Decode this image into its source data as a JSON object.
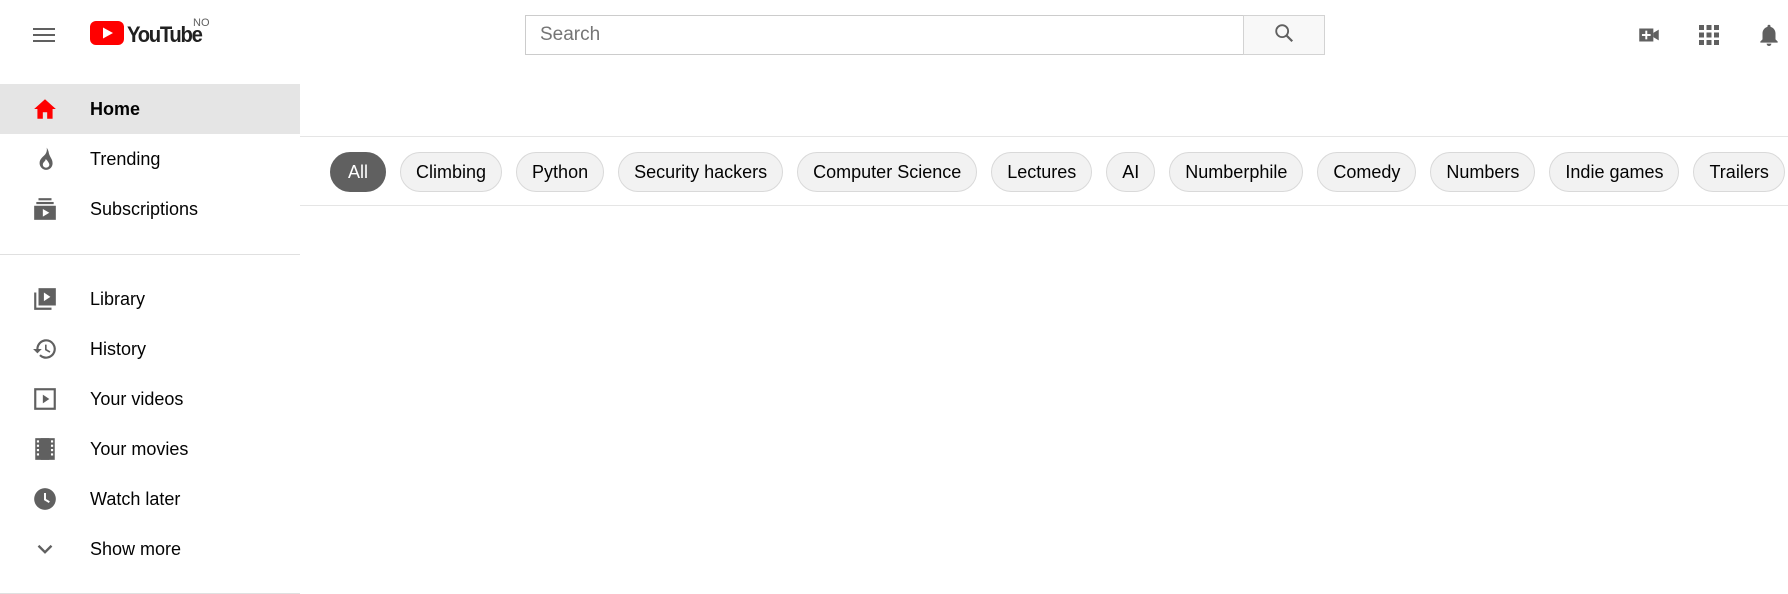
{
  "masthead": {
    "logo_text": "YouTube",
    "country_code": "NO",
    "search_placeholder": "Search",
    "search_value": "",
    "icons": [
      "menu-icon",
      "youtube-logo-icon",
      "search-icon",
      "create-video-icon",
      "apps-icon",
      "notifications-icon"
    ]
  },
  "sidebar": {
    "primary": [
      {
        "label": "Home",
        "icon": "home-icon",
        "active": true
      },
      {
        "label": "Trending",
        "icon": "trending-icon",
        "active": false
      },
      {
        "label": "Subscriptions",
        "icon": "subscriptions-icon",
        "active": false
      }
    ],
    "secondary": [
      {
        "label": "Library",
        "icon": "library-icon"
      },
      {
        "label": "History",
        "icon": "history-icon"
      },
      {
        "label": "Your videos",
        "icon": "your-videos-icon"
      },
      {
        "label": "Your movies",
        "icon": "movies-icon"
      },
      {
        "label": "Watch later",
        "icon": "watch-later-icon"
      },
      {
        "label": "Show more",
        "icon": "chevron-down-icon"
      }
    ]
  },
  "chips": [
    {
      "label": "All",
      "selected": true
    },
    {
      "label": "Climbing",
      "selected": false
    },
    {
      "label": "Python",
      "selected": false
    },
    {
      "label": "Security hackers",
      "selected": false
    },
    {
      "label": "Computer Science",
      "selected": false
    },
    {
      "label": "Lectures",
      "selected": false
    },
    {
      "label": "AI",
      "selected": false
    },
    {
      "label": "Numberphile",
      "selected": false
    },
    {
      "label": "Comedy",
      "selected": false
    },
    {
      "label": "Numbers",
      "selected": false
    },
    {
      "label": "Indie games",
      "selected": false
    },
    {
      "label": "Trailers",
      "selected": false
    },
    {
      "label": "",
      "selected": false
    }
  ],
  "colors": {
    "brand_red": "#ff0000",
    "active_bg": "#e5e5e5",
    "chip_bg": "#f2f2f2",
    "chip_selected_bg": "#606060",
    "icon_gray": "#606060"
  }
}
